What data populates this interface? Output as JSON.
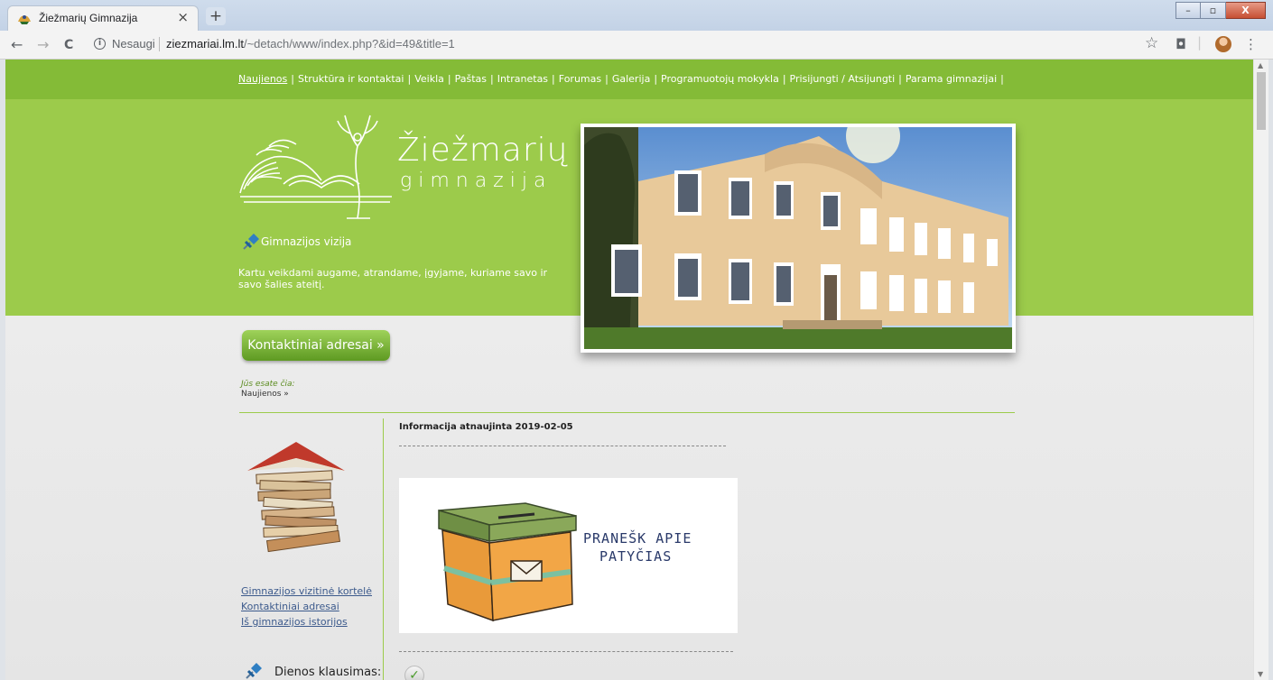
{
  "browser": {
    "tab_title": "Žiežmarių Gimnazija",
    "tab_close": "×",
    "new_tab": "+",
    "insecure_label": "Nesaugi",
    "url_host": "ziezmariai.lm.lt",
    "url_path": "/~detach/www/index.php?&id=49&title=1",
    "back": "←",
    "forward": "→",
    "reload": "C",
    "info": "i",
    "star": "☆",
    "camera": "◘",
    "menu": "⋮",
    "win_min": "–",
    "win_max": "▫",
    "win_close": "X",
    "scroll_up": "▲",
    "scroll_down": "▼"
  },
  "topnav": {
    "items": [
      "Naujienos",
      "Struktūra ir kontaktai",
      "Veikla",
      "Paštas",
      "Intranetas",
      "Forumas",
      "Galerija",
      "Programuotojų mokykla",
      "Prisijungti / Atsijungti",
      "Parama gimnazijai"
    ],
    "separator": "|",
    "active_index": 0
  },
  "header": {
    "logo_main": "Žiežmarių",
    "logo_sub": "gimnazija",
    "vision_title": "Gimnazijos vizija",
    "vision_text": "Kartu veikdami augame, atrandame, įgyjame, kuriame savo ir savo šalies ateitį."
  },
  "contact_button": "Kontaktiniai adresai »",
  "breadcrumb": {
    "label": "Jūs esate čia:",
    "item": "Naujienos »"
  },
  "sidebar": {
    "links": [
      "Gimnazijos vizitinė kortelė",
      "Kontaktiniai adresai",
      "Iš gimnazijos istorijos"
    ],
    "question_title": "Dienos klausimas:"
  },
  "main": {
    "updated": "Informacija atnaujinta 2019-02-05",
    "banner_line1": "PRANEŠK APIE",
    "banner_line2": "PATYČIAS",
    "check": "✓"
  },
  "colors": {
    "nav_green": "#84bb37",
    "header_green": "#9ccb4b",
    "link_blue": "#3c5a8c"
  }
}
